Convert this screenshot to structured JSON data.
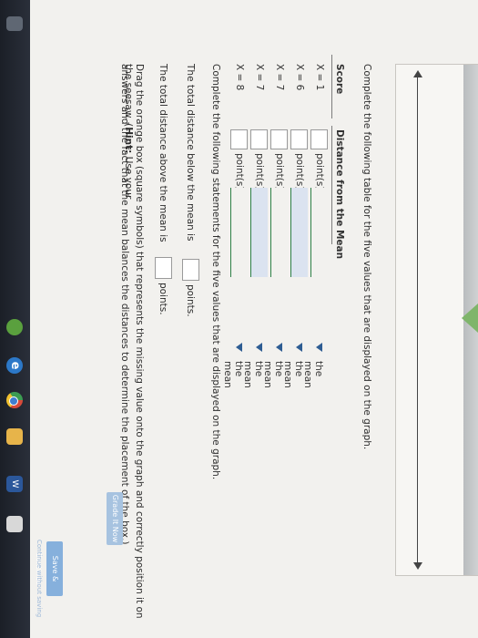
{
  "instructions": {
    "table_prompt": "Complete the following table for the five values that are displayed on the graph.",
    "statements_prompt": "Complete the following statements for the five values that are displayed on the graph.",
    "drag_prompt_line1_a": "Drag the orange box (square symbols) that represents the missing value onto the graph and correctly position it on the seesaw. (",
    "drag_prompt_hint_label": "Hint:",
    "drag_prompt_line1_b": " Use your",
    "drag_prompt_line2": "answers and the fact that the mean balances the distances to determine the placement of the box.)"
  },
  "table": {
    "headers": {
      "score": "Score",
      "distance": "Distance from the Mean"
    },
    "rows": [
      {
        "score": "X = 1",
        "unit": "point(s)",
        "selected": "the mean"
      },
      {
        "score": "X = 6",
        "unit": "point(s)",
        "selected": "the mean"
      },
      {
        "score": "X = 7",
        "unit": "point(s)",
        "selected": "the mean"
      },
      {
        "score": "X = 7",
        "unit": "point(s)",
        "selected": "the mean"
      },
      {
        "score": "X = 8",
        "unit": "point(s)",
        "selected": "the mean"
      }
    ]
  },
  "statements": {
    "below_prefix": "The total distance below the mean is",
    "below_suffix": "points.",
    "above_prefix": "The total distance above the mean is",
    "above_suffix": "points."
  },
  "buttons": {
    "grade": "Grade It Now",
    "save": "Save & Continue",
    "continue_link": "Continue without saving"
  },
  "taskbar": {
    "ie_glyph": "e",
    "word_glyph": "W"
  }
}
